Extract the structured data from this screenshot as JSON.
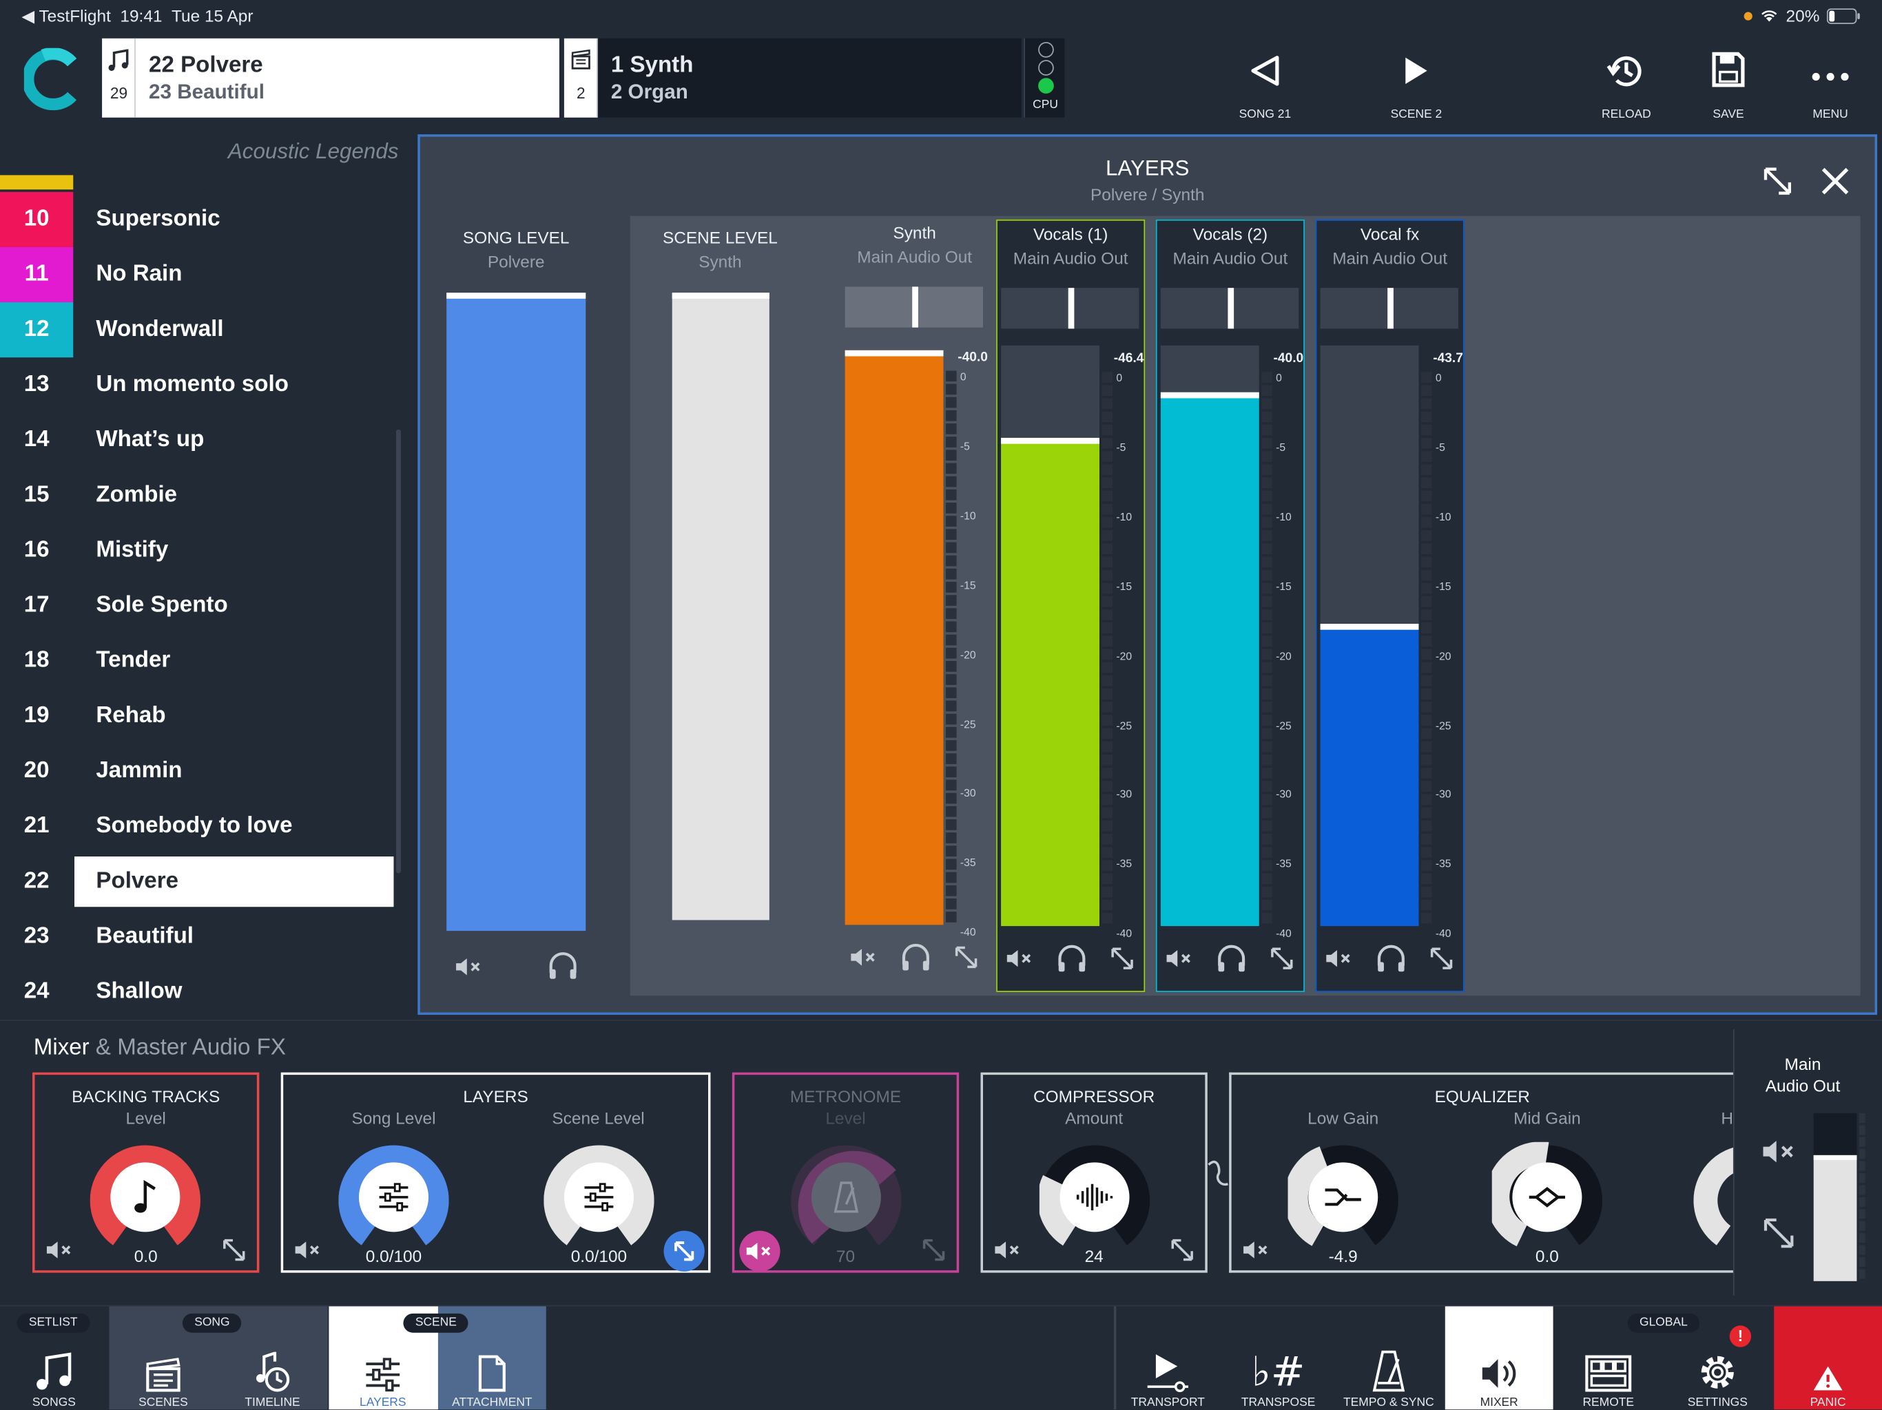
{
  "status_bar": {
    "back_app": "◀ TestFlight",
    "time": "19:41",
    "date": "Tue 15 Apr",
    "battery": "20%"
  },
  "header": {
    "song_box": {
      "number": "29",
      "line1": "22 Polvere",
      "line2": "23 Beautiful"
    },
    "scene_box": {
      "number": "2",
      "line1": "1 Synth",
      "line2": "2 Organ"
    },
    "cpu_label": "CPU",
    "buttons": [
      {
        "label": "SONG 21",
        "icon": "triangle-left-icon"
      },
      {
        "label": "SCENE 2",
        "icon": "play-icon"
      },
      {
        "label": "RELOAD",
        "icon": "reload-icon"
      },
      {
        "label": "SAVE",
        "icon": "save-icon"
      },
      {
        "label": "MENU",
        "icon": "more-icon"
      }
    ]
  },
  "setlist": {
    "title": "Acoustic Legends",
    "items": [
      {
        "num": "10",
        "title": "Supersonic",
        "color": "#f0145a"
      },
      {
        "num": "11",
        "title": "No Rain",
        "color": "#e21bd0"
      },
      {
        "num": "12",
        "title": "Wonderwall",
        "color": "#12b6ca"
      },
      {
        "num": "13",
        "title": "Un momento solo",
        "color": ""
      },
      {
        "num": "14",
        "title": "What’s up",
        "color": ""
      },
      {
        "num": "15",
        "title": "Zombie",
        "color": ""
      },
      {
        "num": "16",
        "title": "Mistify",
        "color": ""
      },
      {
        "num": "17",
        "title": "Sole Spento",
        "color": ""
      },
      {
        "num": "18",
        "title": "Tender",
        "color": ""
      },
      {
        "num": "19",
        "title": "Rehab",
        "color": ""
      },
      {
        "num": "20",
        "title": "Jammin",
        "color": ""
      },
      {
        "num": "21",
        "title": "Somebody to love",
        "color": ""
      },
      {
        "num": "22",
        "title": "Polvere",
        "color": "",
        "selected": true
      },
      {
        "num": "23",
        "title": "Beautiful",
        "color": ""
      },
      {
        "num": "24",
        "title": "Shallow",
        "color": ""
      }
    ]
  },
  "layers": {
    "title": "LAYERS",
    "subtitle": "Polvere / Synth",
    "song_level": {
      "label": "SONG LEVEL",
      "sub": "Polvere",
      "color": "#4f8ae8"
    },
    "scene_level": {
      "label": "SCENE LEVEL",
      "sub": "Synth",
      "color": "#e3e3e3"
    },
    "scale": [
      "0",
      "-5",
      "-10",
      "-15",
      "-20",
      "-25",
      "-30",
      "-35",
      "-40"
    ],
    "channels": [
      {
        "name": "Synth",
        "output": "Main Audio Out",
        "db": "-40.0",
        "color": "#e8740a",
        "level_fraction": 0.99
      },
      {
        "name": "Vocals (1)",
        "output": "Main Audio Out",
        "db": "-46.4",
        "color": "#9bd408",
        "level_fraction": 0.84
      },
      {
        "name": "Vocals (2)",
        "output": "Main Audio Out",
        "db": "-40.0",
        "color": "#02bcd4",
        "level_fraction": 0.92
      },
      {
        "name": "Vocal fx",
        "output": "Main Audio Out",
        "db": "-43.7",
        "color": "#0a5ed8",
        "level_fraction": 0.52
      }
    ]
  },
  "mixer": {
    "title": "Mixer",
    "title_rest": " & Master Audio FX",
    "backing": {
      "title": "BACKING TRACKS",
      "sub": "Level",
      "value": "0.0"
    },
    "layers": {
      "title": "LAYERS",
      "sub1": "Song Level",
      "sub2": "Scene Level",
      "value1": "0.0/100",
      "value2": "0.0/100"
    },
    "metronome": {
      "title": "METRONOME",
      "sub": "Level",
      "value": "70"
    },
    "compressor": {
      "title": "COMPRESSOR",
      "sub": "Amount",
      "value": "24"
    },
    "equalizer": {
      "title": "EQUALIZER",
      "sub1": "Low Gain",
      "sub2": "Mid Gain",
      "sub3": "H",
      "value1": "-4.9",
      "value2": "0.0"
    },
    "main_out": {
      "line1": "Main",
      "line2": "Audio Out"
    }
  },
  "bottom_nav": {
    "pills": {
      "setlist": "SETLIST",
      "song": "SONG",
      "scene": "SCENE",
      "global": "GLOBAL"
    },
    "tabs": [
      {
        "label": "SONGS"
      },
      {
        "label": "SCENES"
      },
      {
        "label": "TIMELINE"
      },
      {
        "label": "LAYERS"
      },
      {
        "label": "ATTACHMENT"
      },
      {
        "label": "TRANSPORT"
      },
      {
        "label": "TRANSPOSE"
      },
      {
        "label": "TEMPO & SYNC"
      },
      {
        "label": "MIXER"
      },
      {
        "label": "REMOTE"
      },
      {
        "label": "SETTINGS"
      },
      {
        "label": "PANIC"
      }
    ],
    "settings_badge": "!",
    "transpose_glyph": "♭#"
  },
  "colors": {
    "accent_blue": "#3d77c8",
    "backing_red": "#e8474a",
    "metronome_pink": "#c8419a",
    "panic_red": "#d81a2a"
  }
}
